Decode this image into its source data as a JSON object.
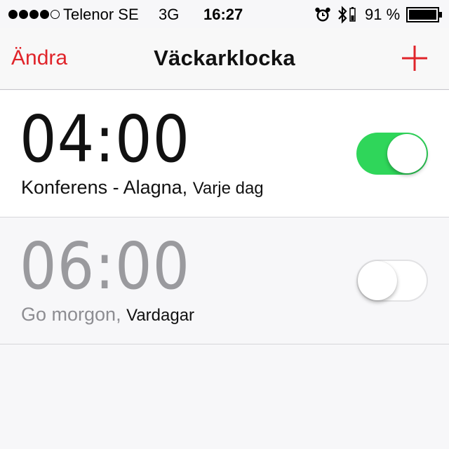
{
  "status_bar": {
    "signal_bars_filled": 4,
    "signal_bars_total": 5,
    "carrier": "Telenor SE",
    "network": "3G",
    "time": "16:27",
    "battery_percent": "91 %",
    "icons": [
      "alarm-clock-icon",
      "bluetooth-icon",
      "battery-icon"
    ]
  },
  "nav": {
    "edit_label": "Ändra",
    "title": "Väckarklocka",
    "add_icon": "plus-icon",
    "accent_color": "#e0242a"
  },
  "alarms": [
    {
      "time": "04:00",
      "label": "Konferens - Alagna,",
      "repeat": "Varje dag",
      "enabled": true
    },
    {
      "time": "06:00",
      "label": "Go morgon,",
      "repeat": "Vardagar",
      "enabled": false
    }
  ],
  "colors": {
    "toggle_on": "#2fd65a",
    "title_text": "#111111"
  }
}
